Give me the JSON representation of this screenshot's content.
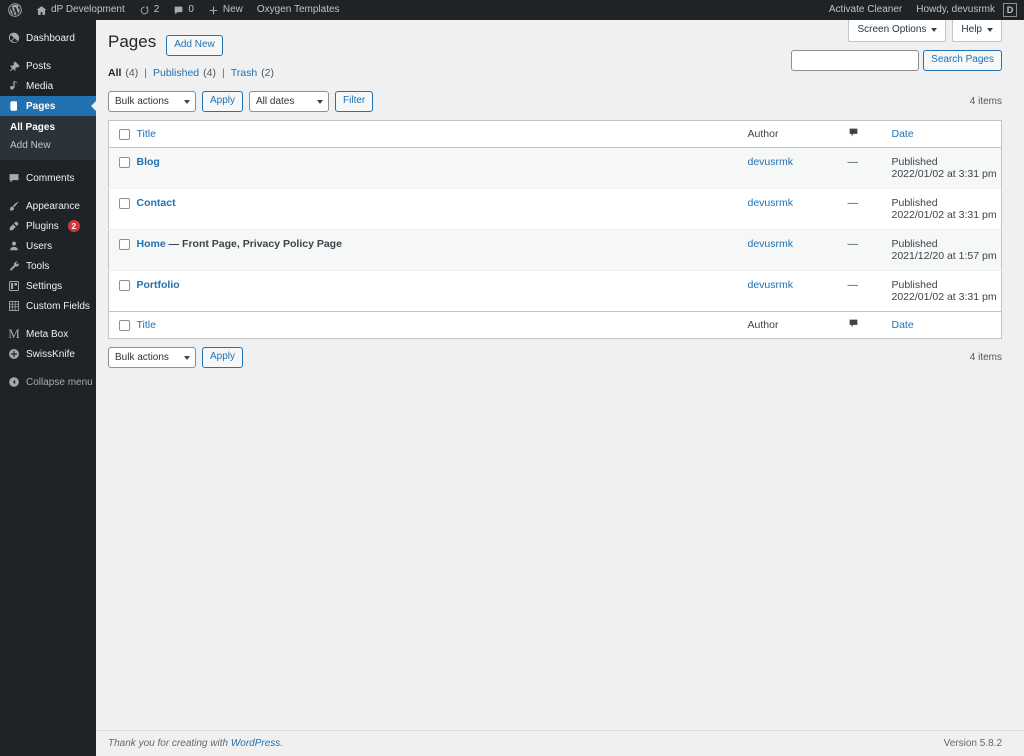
{
  "adminbar": {
    "wp_logo_icon": "wordpress-logo-icon",
    "site_icon": "home-icon",
    "site_name": "dP Development",
    "updates_icon": "updates-icon",
    "updates_count": "2",
    "comments_icon": "comment-bubble-icon",
    "comments_count": "0",
    "new_icon": "plus-icon",
    "new_label": "New",
    "oxygen_label": "Oxygen Templates",
    "activate_cleaner": "Activate Cleaner",
    "howdy": "Howdy, devusrmk",
    "avatar_letter": "D"
  },
  "sidebar": {
    "items": [
      {
        "label": "Dashboard",
        "icon": "dashboard-icon",
        "name": "dashboard"
      },
      {
        "label": "Posts",
        "icon": "pin-icon",
        "name": "posts"
      },
      {
        "label": "Media",
        "icon": "media-icon",
        "name": "media"
      },
      {
        "label": "Pages",
        "icon": "pages-icon",
        "name": "pages",
        "current": true
      },
      {
        "label": "Comments",
        "icon": "comment-bubble-icon",
        "name": "comments"
      },
      {
        "label": "Appearance",
        "icon": "paintbrush-icon",
        "name": "appearance"
      },
      {
        "label": "Plugins",
        "icon": "plugin-icon",
        "name": "plugins",
        "badge": "2"
      },
      {
        "label": "Users",
        "icon": "user-icon",
        "name": "users"
      },
      {
        "label": "Tools",
        "icon": "wrench-icon",
        "name": "tools"
      },
      {
        "label": "Settings",
        "icon": "settings-icon",
        "name": "settings"
      },
      {
        "label": "Custom Fields",
        "icon": "custom-fields-icon",
        "name": "custom-fields"
      },
      {
        "label": "Meta Box",
        "icon": "metabox-m-icon",
        "name": "meta-box"
      },
      {
        "label": "SwissKnife",
        "icon": "plus-circle-icon",
        "name": "swissknife"
      }
    ],
    "submenu": [
      {
        "label": "All Pages",
        "current": true
      },
      {
        "label": "Add New",
        "current": false
      }
    ],
    "collapse": {
      "label": "Collapse menu",
      "icon": "collapse-arrow-icon"
    }
  },
  "screen_meta": {
    "screen_options": "Screen Options",
    "help": "Help"
  },
  "header": {
    "title": "Pages",
    "add_new": "Add New"
  },
  "views": {
    "all_label": "All",
    "all_count": "(4)",
    "published_label": "Published",
    "published_count": "(4)",
    "trash_label": "Trash",
    "trash_count": "(2)"
  },
  "search": {
    "value": "",
    "placeholder": "",
    "button": "Search Pages"
  },
  "tablenav_top": {
    "bulk_actions": "Bulk actions",
    "apply": "Apply",
    "dates": "All dates",
    "filter": "Filter",
    "items": "4 items"
  },
  "tablenav_bottom": {
    "bulk_actions": "Bulk actions",
    "apply": "Apply",
    "items": "4 items"
  },
  "table": {
    "columns": {
      "title": "Title",
      "author": "Author",
      "comments_icon": "comment-bubble-icon",
      "date": "Date"
    },
    "rows": [
      {
        "title": "Blog",
        "state": "",
        "author": "devusrmk",
        "comments": "—",
        "date_status": "Published",
        "date_value": "2022/01/02 at 3:31 pm"
      },
      {
        "title": "Contact",
        "state": "",
        "author": "devusrmk",
        "comments": "—",
        "date_status": "Published",
        "date_value": "2022/01/02 at 3:31 pm"
      },
      {
        "title": "Home",
        "state": "— Front Page, Privacy Policy Page",
        "author": "devusrmk",
        "comments": "—",
        "date_status": "Published",
        "date_value": "2021/12/20 at 1:57 pm"
      },
      {
        "title": "Portfolio",
        "state": "",
        "author": "devusrmk",
        "comments": "—",
        "date_status": "Published",
        "date_value": "2022/01/02 at 3:31 pm"
      }
    ]
  },
  "footer": {
    "thanks_prefix": "Thank you for creating with ",
    "wordpress_link": "WordPress",
    "thanks_suffix": ".",
    "version": "Version 5.8.2"
  },
  "colors": {
    "admin_bar_bg": "#1d2327",
    "menu_bg": "#1d2327",
    "menu_current": "#2271b1",
    "submenu_bg": "#2c3338",
    "link": "#2271b1",
    "badge": "#d63638",
    "content_bg": "#f0f0f1",
    "row_alt": "#f6f7f7"
  }
}
